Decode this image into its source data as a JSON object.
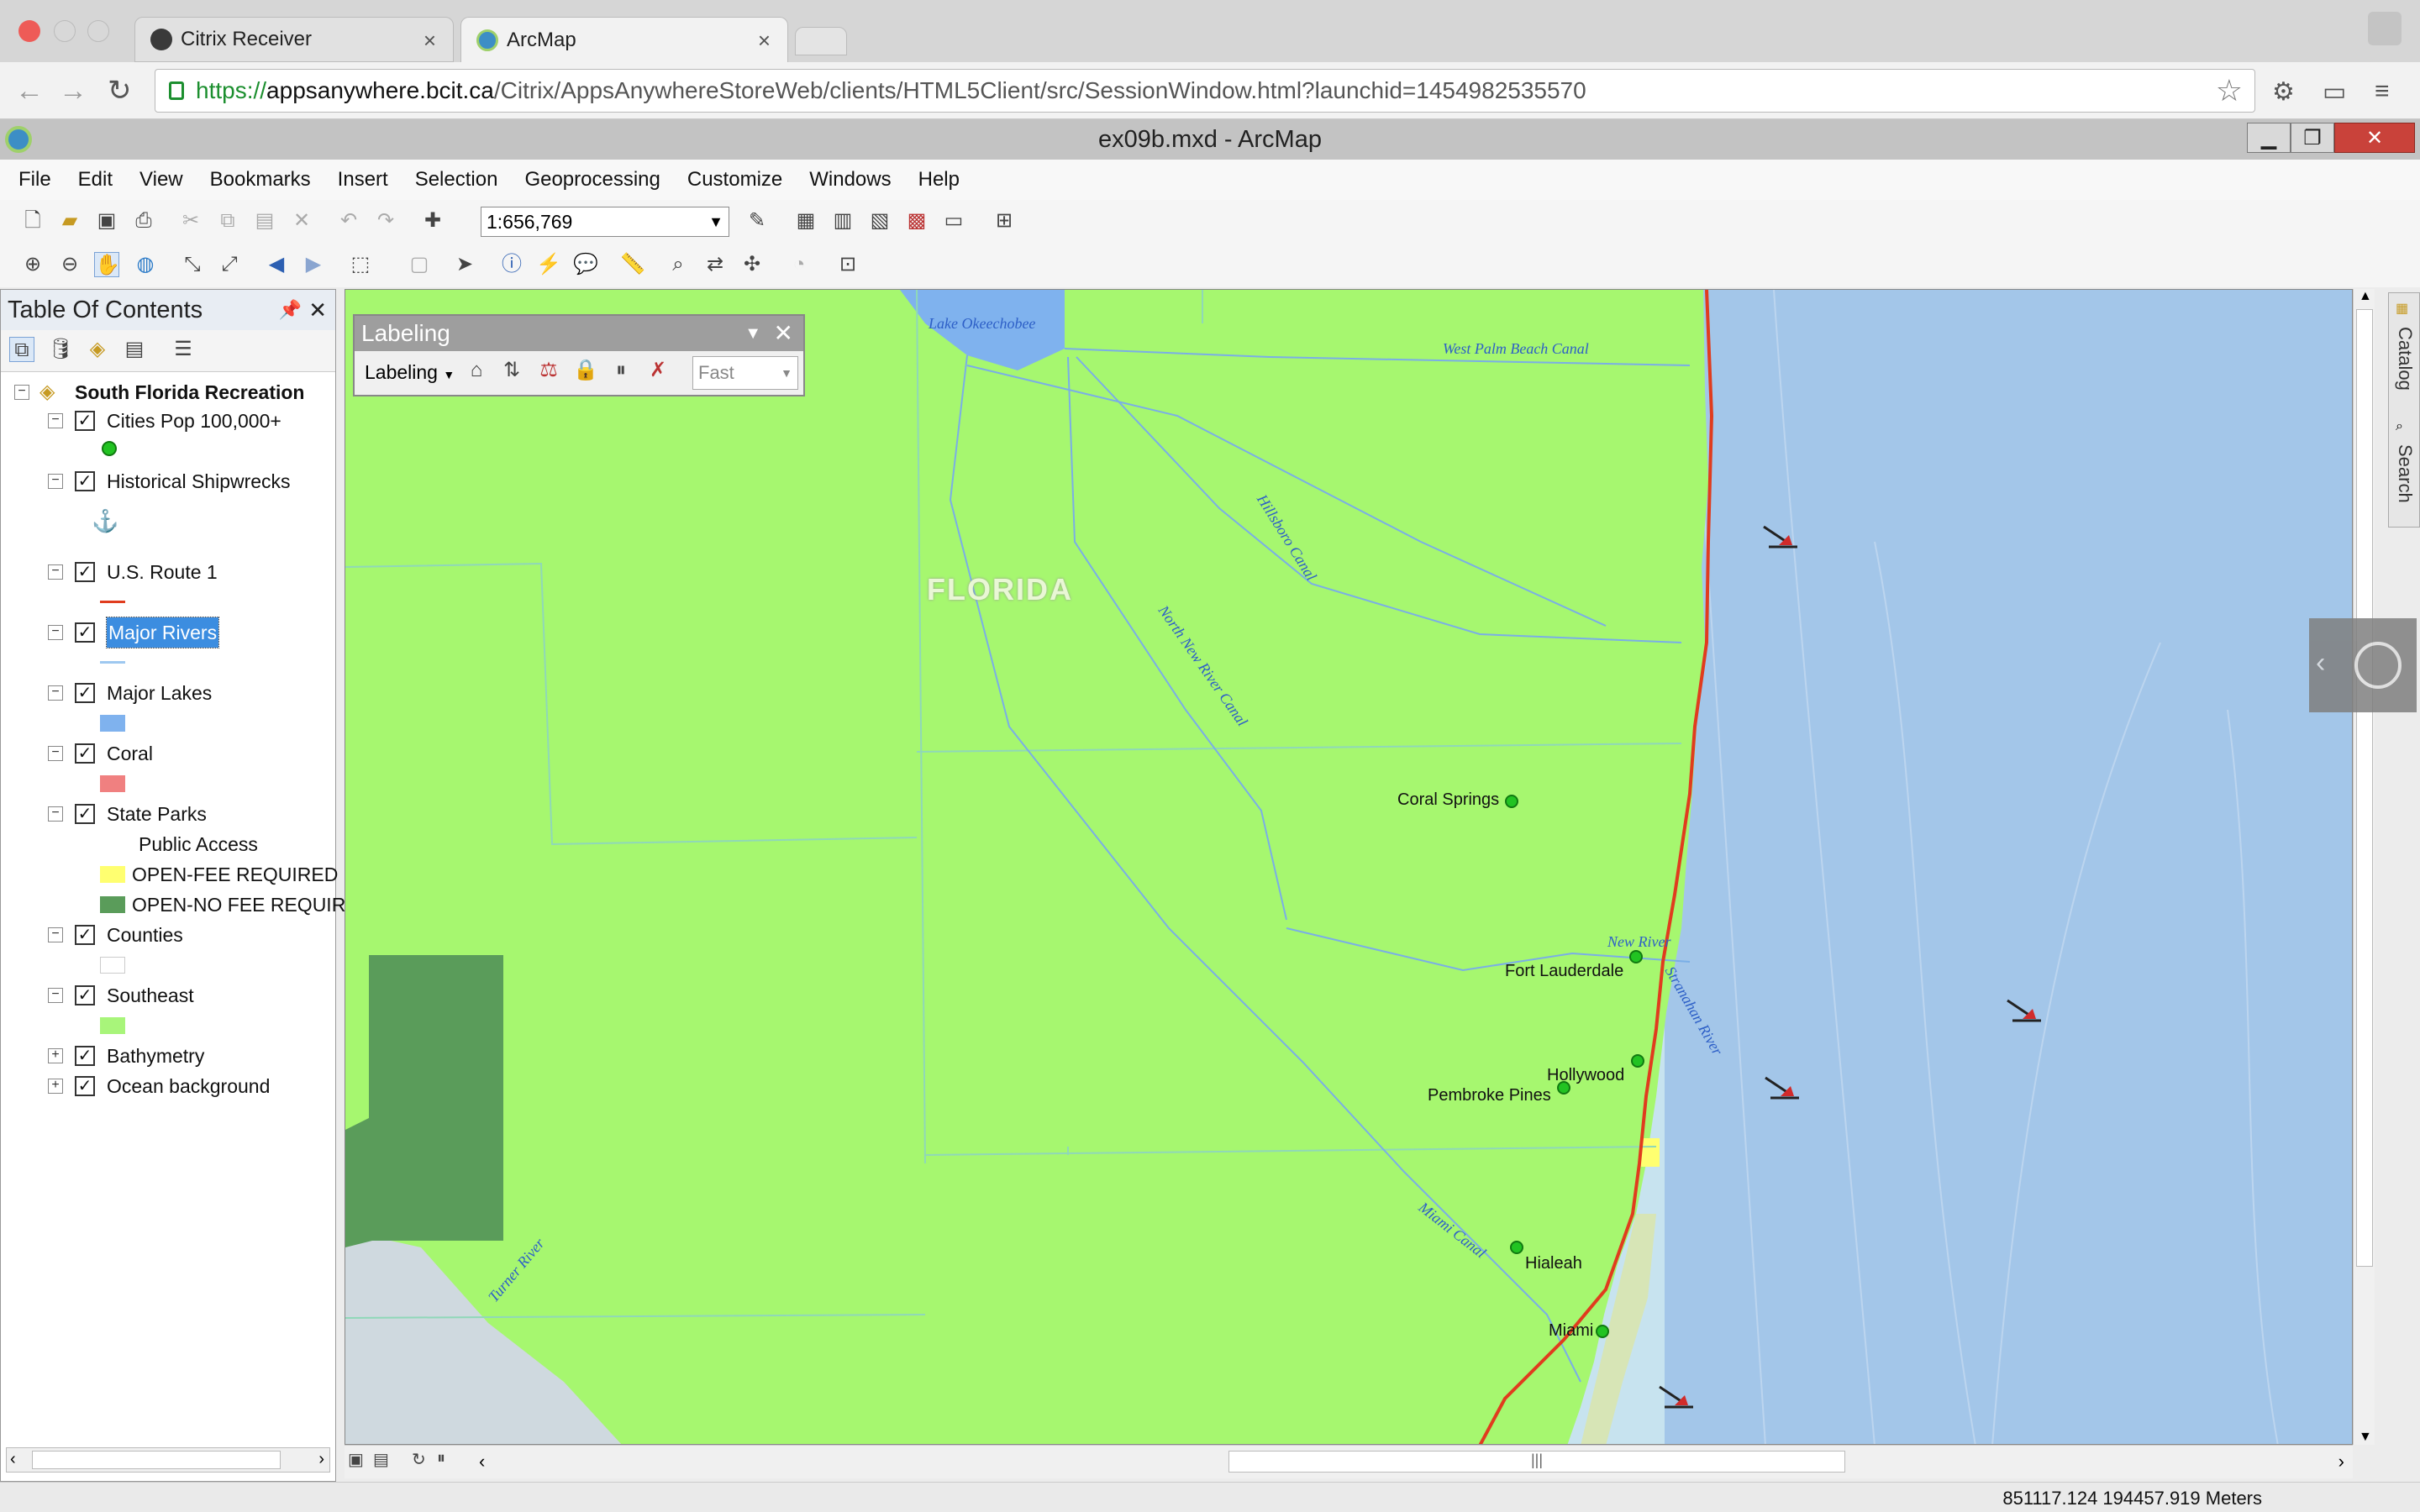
{
  "browser": {
    "tabs": [
      {
        "title": "Citrix Receiver",
        "active": false
      },
      {
        "title": "ArcMap",
        "active": true
      }
    ],
    "url": {
      "scheme": "https://",
      "host": "appsanywhere.bcit.ca",
      "path": "/Citrix/AppsAnywhereStoreWeb/clients/HTML5Client/src/SessionWindow.html?launchid=1454982535570"
    }
  },
  "app": {
    "window_title": "ex09b.mxd - ArcMap",
    "menus": [
      "File",
      "Edit",
      "View",
      "Bookmarks",
      "Insert",
      "Selection",
      "Geoprocessing",
      "Customize",
      "Windows",
      "Help"
    ],
    "scale": "1:656,769"
  },
  "toc": {
    "title": "Table Of Contents",
    "map_name": "South Florida Recreation",
    "layers": [
      {
        "name": "Cities Pop 100,000+",
        "checked": true,
        "expanded": true
      },
      {
        "name": "Historical Shipwrecks",
        "checked": true,
        "expanded": true
      },
      {
        "name": "U.S. Route 1",
        "checked": true,
        "expanded": true
      },
      {
        "name": "Major Rivers",
        "checked": true,
        "expanded": true,
        "selected": true
      },
      {
        "name": "Major Lakes",
        "checked": true,
        "expanded": true
      },
      {
        "name": "Coral",
        "checked": true,
        "expanded": true
      },
      {
        "name": "State Parks",
        "checked": true,
        "expanded": true
      },
      {
        "name": "Counties",
        "checked": true,
        "expanded": true
      },
      {
        "name": "Southeast",
        "checked": true,
        "expanded": true
      },
      {
        "name": "Bathymetry",
        "checked": true,
        "expanded": false
      },
      {
        "name": "Ocean background",
        "checked": true,
        "expanded": false
      }
    ],
    "state_parks": {
      "field": "Public Access",
      "classes": [
        {
          "label": "OPEN-FEE REQUIRED",
          "color": "#ffff70"
        },
        {
          "label": "OPEN-NO FEE REQUIR",
          "color": "#5a9c5a"
        }
      ]
    },
    "colors": {
      "cities": "#22c322",
      "route": "#e03c1e",
      "rivers": "#9ec8f0",
      "lakes": "#7fb2ee",
      "coral": "#f08080",
      "counties": "#ffffff",
      "southeast": "#a8f57a"
    }
  },
  "labeling_toolbar": {
    "title": "Labeling",
    "menu": "Labeling",
    "quality": "Fast"
  },
  "map": {
    "state_label": "FLORIDA",
    "cities": [
      "Coral Springs",
      "Fort Lauderdale",
      "Hollywood",
      "Pembroke Pines",
      "Hialeah",
      "Miami"
    ],
    "water_labels": {
      "lake": "Lake Okeechobee",
      "west_palm": "West Palm Beach Canal",
      "hillsboro": "Hillsboro Canal",
      "north_new": "North New River Canal",
      "new_river": "New River",
      "stranahan": "Stranahan River",
      "miami_canal": "Miami Canal",
      "turner": "Turner River"
    },
    "land_color": "#a6f76f",
    "ocean_color": "#a3c6e9"
  },
  "side_tabs": [
    "Catalog",
    "Search"
  ],
  "status": {
    "coordinates": "851117.124  194457.919 Meters"
  }
}
